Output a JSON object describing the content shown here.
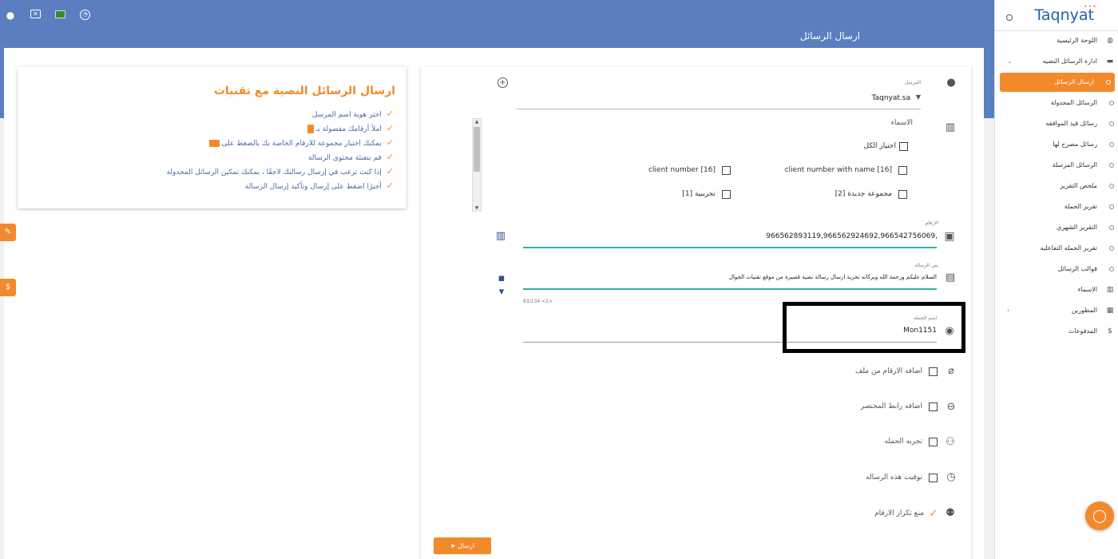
{
  "header": {
    "page_title": "ارسال الرسائل"
  },
  "sidebar": {
    "logo": "Taqnyat",
    "items": [
      {
        "label": "اللوحة الرئيسية",
        "icon": "dashboard-icon"
      },
      {
        "label": "ادارة الرسائل النصيه",
        "icon": "message-box-icon"
      },
      {
        "label": "ارسال الرسائل",
        "icon": "circle-icon",
        "active": true
      },
      {
        "label": "الرسائل المجدولة",
        "icon": "circle-icon"
      },
      {
        "label": "رسائل قيد الموافقه",
        "icon": "circle-icon"
      },
      {
        "label": "رسائل مصرح لها",
        "icon": "circle-icon"
      },
      {
        "label": "الرسائل المرسلة",
        "icon": "circle-icon"
      },
      {
        "label": "ملخص التقرير",
        "icon": "circle-icon"
      },
      {
        "label": "تقرير الحملة",
        "icon": "circle-icon"
      },
      {
        "label": "التقرير الشهري",
        "icon": "circle-icon"
      },
      {
        "label": "تقرير الحمله التفاعليه",
        "icon": "circle-icon"
      },
      {
        "label": "قوالب الرسائل",
        "icon": "circle-icon"
      },
      {
        "label": "الاسماء",
        "icon": "contacts-book-icon"
      },
      {
        "label": "المطورين",
        "icon": "developer-icon"
      },
      {
        "label": "المدفوعات",
        "icon": "dollar-icon"
      }
    ]
  },
  "info": {
    "title": "ارسال الرسائل النصية مع تقنيات",
    "items": [
      "اختر هوية اسم المرسل",
      "املأ أرقامك مفصولة بـ",
      "بمكنك اختيار مجموعة للارقام الخاصة بك بالضغط على",
      "قم بتعبئة محتوى الرسالة",
      "إذا كنت ترغب في إرسال رسالتك لاحقًا ، يمكنك تمكين الرسائل المجدولة",
      "أخيرًا اضغط على إرسال وتأكيد إرسال الرسالة"
    ]
  },
  "form": {
    "sender_label": "المرسل",
    "sender_value": "Taqnyat.sa",
    "names_label": "الاسماء",
    "select_all": "اختيار الكل",
    "groups": [
      {
        "label": "client number with name [16]"
      },
      {
        "label": "client number [16]"
      },
      {
        "label": "مجموعة جديدة [2]"
      },
      {
        "label": "تجريبية [1]"
      }
    ],
    "numbers_label": "الارقام",
    "numbers_value": "966562893119,966562924692,966542756069,",
    "message_label": "نص الرسالة",
    "message_value": "السلام عليكم ورحمة الله وبركاته تجربة ارسال رسالة نصية قصيرة من موقع تقنيات الجوال",
    "char_count": "83/134 <2>",
    "campaign_label": "اسم الحملة",
    "campaign_value": "Mon1151",
    "options": [
      {
        "label": "اضافه الارقام من ملف",
        "icon": "paperclip-icon"
      },
      {
        "label": "اضافه رابط المختصر",
        "icon": "link-icon"
      },
      {
        "label": "تجربه الحمله",
        "icon": "people-icon"
      },
      {
        "label": "توقيت هذه الرساله",
        "icon": "clock-icon"
      },
      {
        "label": "منع تكرار الارقام",
        "icon": "group-icon"
      }
    ],
    "send_label": "ارسال"
  }
}
